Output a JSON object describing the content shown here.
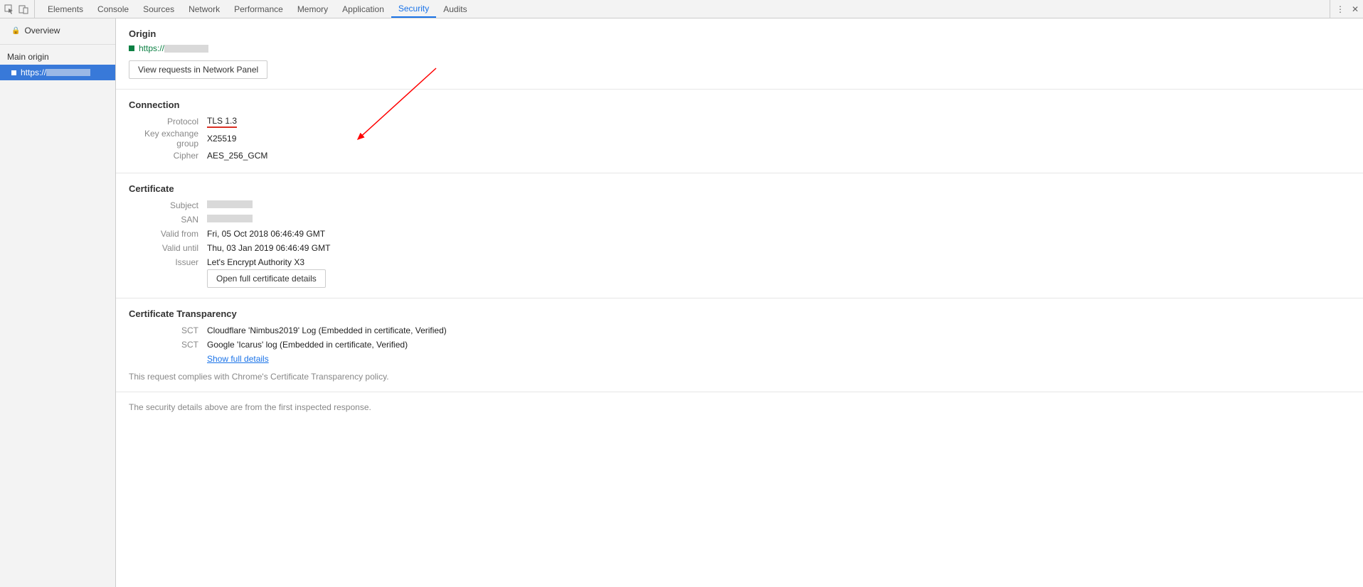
{
  "tabs": [
    "Elements",
    "Console",
    "Sources",
    "Network",
    "Performance",
    "Memory",
    "Application",
    "Security",
    "Audits"
  ],
  "active_tab": "Security",
  "sidebar": {
    "overview": "Overview",
    "main_origin": "Main origin",
    "selected_origin_prefix": "https://"
  },
  "origin": {
    "heading": "Origin",
    "url_prefix": "https://",
    "view_requests_btn": "View requests in Network Panel"
  },
  "connection": {
    "heading": "Connection",
    "rows": [
      {
        "k": "Protocol",
        "v": "TLS 1.3",
        "highlight": true
      },
      {
        "k": "Key exchange group",
        "v": "X25519"
      },
      {
        "k": "Cipher",
        "v": "AES_256_GCM"
      }
    ]
  },
  "certificate": {
    "heading": "Certificate",
    "rows": [
      {
        "k": "Subject",
        "v": ""
      },
      {
        "k": "SAN",
        "v": ""
      },
      {
        "k": "Valid from",
        "v": "Fri, 05 Oct 2018 06:46:49 GMT"
      },
      {
        "k": "Valid until",
        "v": "Thu, 03 Jan 2019 06:46:49 GMT"
      },
      {
        "k": "Issuer",
        "v": "Let's Encrypt Authority X3"
      }
    ],
    "open_btn": "Open full certificate details"
  },
  "ct": {
    "heading": "Certificate Transparency",
    "rows": [
      {
        "k": "SCT",
        "v": "Cloudflare 'Nimbus2019' Log (Embedded in certificate, Verified)"
      },
      {
        "k": "SCT",
        "v": "Google 'Icarus' log (Embedded in certificate, Verified)"
      }
    ],
    "link": "Show full details",
    "compliance": "This request complies with Chrome's Certificate Transparency policy."
  },
  "footer": "The security details above are from the first inspected response."
}
